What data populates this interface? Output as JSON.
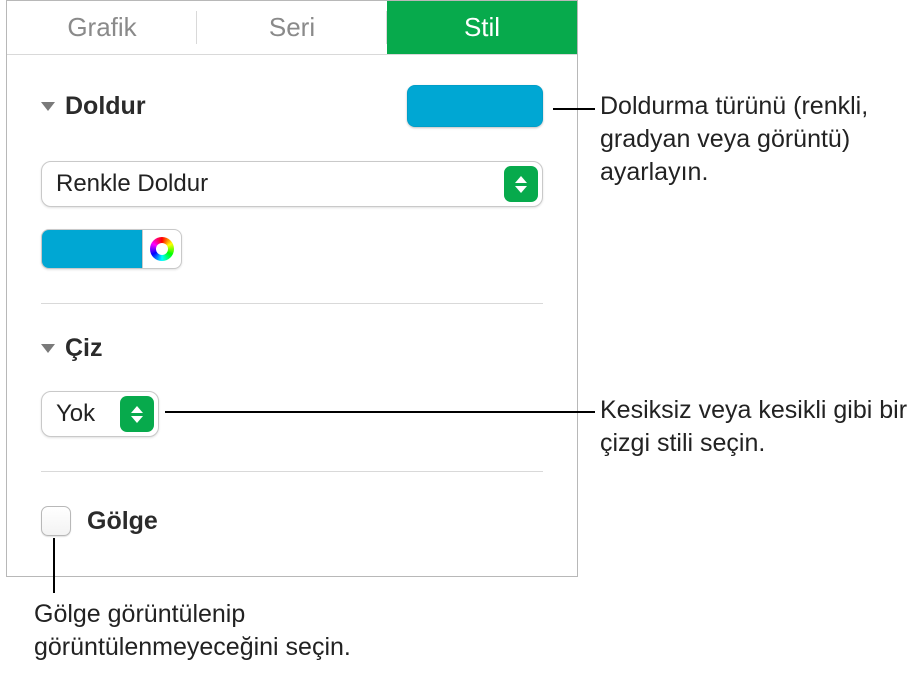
{
  "tabs": {
    "grafik": "Grafik",
    "seri": "Seri",
    "stil": "Stil"
  },
  "fill": {
    "header": "Doldur",
    "popup_value": "Renkle Doldur",
    "swatch_color": "#00a7d3"
  },
  "stroke": {
    "header": "Çiz",
    "popup_value": "Yok"
  },
  "shadow": {
    "label": "Gölge"
  },
  "callouts": {
    "fill": "Doldurma türünü (renkli, gradyan veya görüntü) ayarlayın.",
    "stroke": "Kesiksiz veya kesikli gibi bir çizgi stili seçin.",
    "shadow": "Gölge görüntülenip görüntülenmeyeceğini seçin."
  }
}
